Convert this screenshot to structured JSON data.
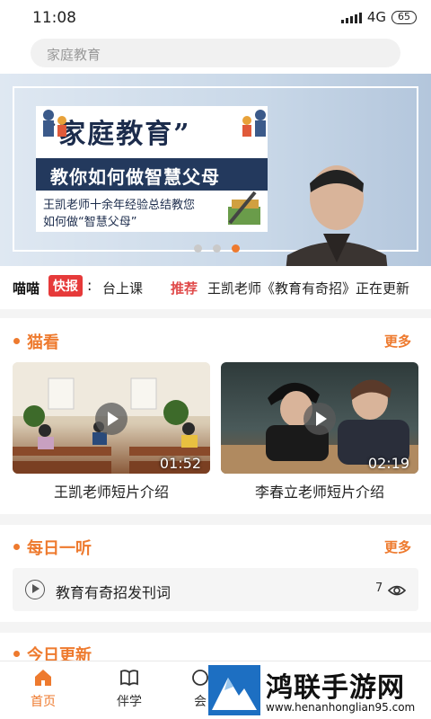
{
  "status_bar": {
    "time": "11:08",
    "network": "4G",
    "battery": "65"
  },
  "search": {
    "placeholder": "家庭教育"
  },
  "banner": {
    "title": "“家庭教育”",
    "subtitle": "教你如何做智慧父母",
    "desc_line1": "王凯老师十余年经验总结教您",
    "desc_line2": "如何做“智慧父母”"
  },
  "ticker": {
    "brand": "喵喵",
    "badge": "快报",
    "colon": ":",
    "item1": "台上课",
    "tag": "推荐",
    "item2": "王凯老师《教育有奇招》正在更新"
  },
  "section_watch": {
    "title": "猫看",
    "more": "更多",
    "videos": [
      {
        "label": "王凯老师短片介绍",
        "duration": "01:52"
      },
      {
        "label": "李春立老师短片介绍",
        "duration": "02:19"
      }
    ]
  },
  "section_listen": {
    "title": "每日一听",
    "more": "更多",
    "item": {
      "title": "教育有奇招发刊词",
      "views": "7"
    }
  },
  "section_update": {
    "title": "今日更新"
  },
  "nav": {
    "home": "首页",
    "study": "伴学",
    "third": "会"
  },
  "watermark": {
    "text": "鸿联手游网",
    "url": "www.henanhonglian95.com"
  },
  "colors": {
    "accent": "#ee7a2e",
    "badge": "#e63a3a",
    "banner_navy": "#23395d"
  },
  "icons": [
    "play-icon",
    "eye-icon",
    "home-icon",
    "book-icon"
  ]
}
